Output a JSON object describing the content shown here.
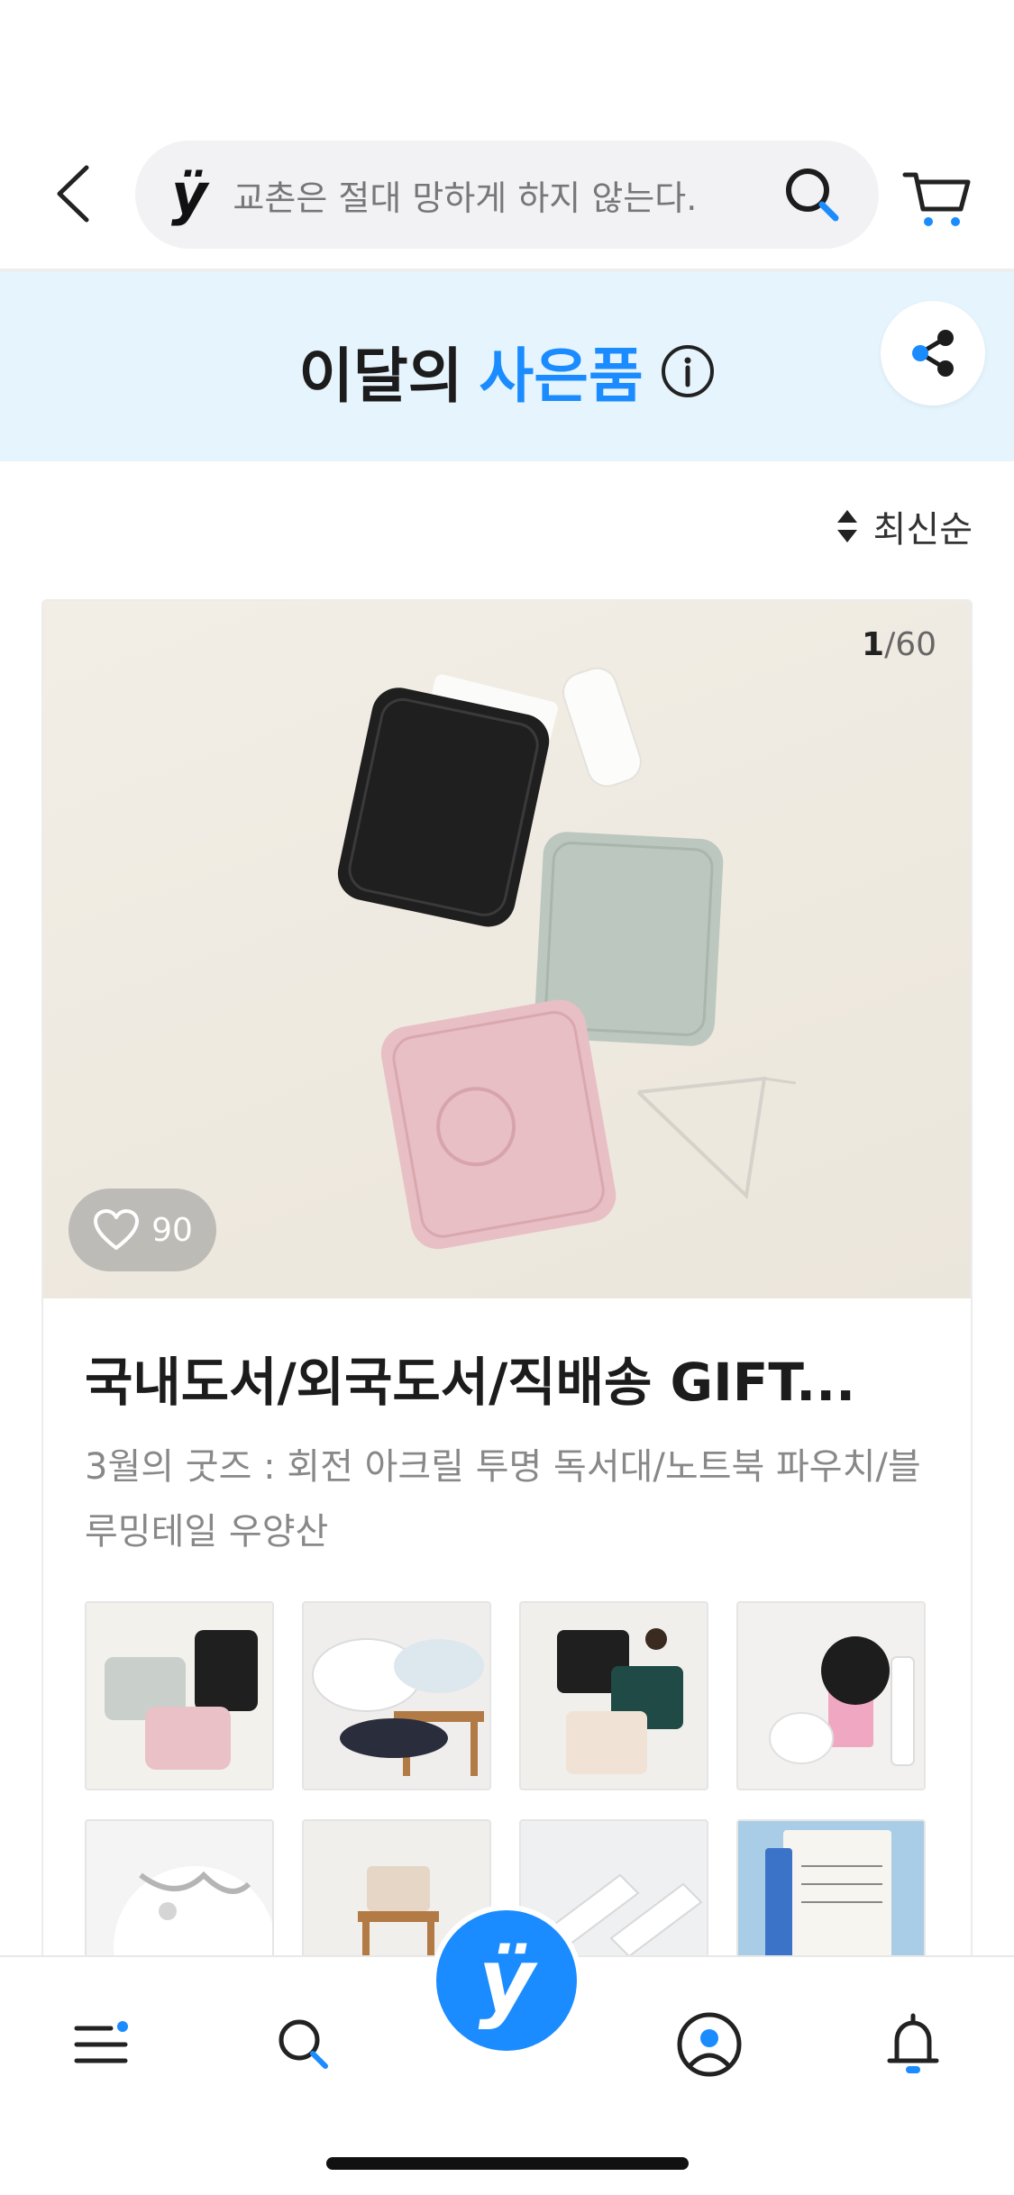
{
  "header": {
    "logo_text": "ÿ",
    "search_placeholder": "교촌은 절대 망하게 하지 않는다."
  },
  "banner": {
    "title_prefix": "이달의",
    "title_accent": "사은품"
  },
  "sort": {
    "label": "최신순"
  },
  "card": {
    "counter_current": "1",
    "counter_total": "/60",
    "likes": "90",
    "title": "국내도서/외국도서/직배송 GIFT...",
    "subtitle": "3월의 굿즈 : 회전 아크릴 투명 독서대/노트북 파우치/블루밍테일 우양산"
  },
  "nav": {
    "center_logo": "ÿ"
  },
  "colors": {
    "accent": "#1a8cff",
    "banner_bg": "#e6f4fd"
  }
}
